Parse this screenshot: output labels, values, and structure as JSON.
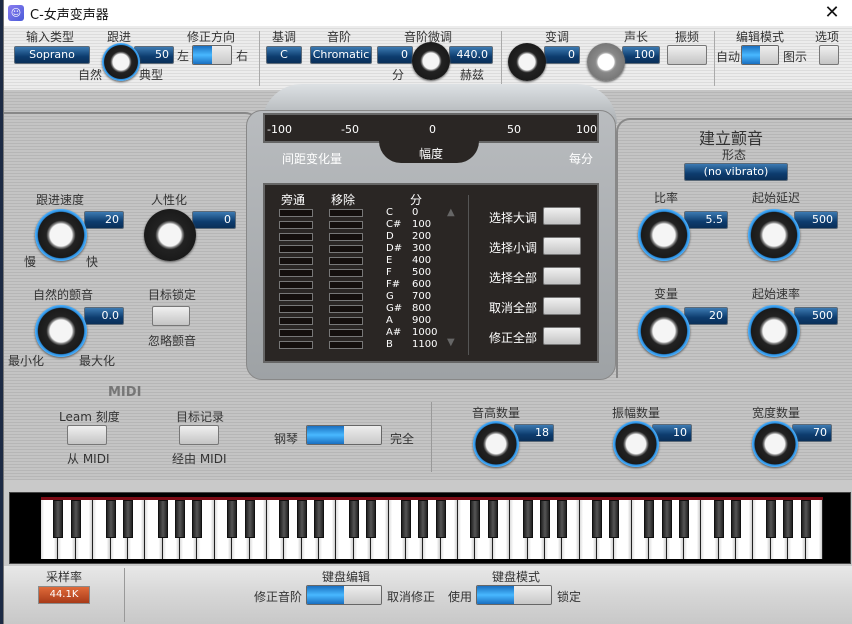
{
  "window": {
    "title": "C-女声变声器",
    "close_icon": "✕"
  },
  "top": {
    "input_type": {
      "label": "输入类型",
      "value": "Soprano"
    },
    "retune": {
      "label": "跟进",
      "value": "50",
      "left": "自然",
      "right": "典型"
    },
    "correction_dir": {
      "label": "修正方向",
      "left": "左",
      "right": "右",
      "state": "left"
    },
    "key": {
      "label": "基调",
      "value": "C"
    },
    "scale": {
      "label": "音阶",
      "value": "Chromatic"
    },
    "scale_detune": {
      "label": "音阶微调",
      "cents": "0",
      "hz": "440.0",
      "minus_label": "分",
      "plus_label": "赫兹"
    },
    "transpose": {
      "label": "变调",
      "value": "0"
    },
    "formant": {
      "label": "声长",
      "value": "100"
    },
    "vibrato_btn": {
      "label": "振频"
    },
    "edit_mode": {
      "label": "编辑模式",
      "left": "自动",
      "right": "图示",
      "state": "left"
    },
    "options": {
      "label": "选项"
    },
    "minus": "-",
    "plus": "+"
  },
  "meter": {
    "ticks": [
      "-100",
      "-50",
      "0",
      "50",
      "100"
    ],
    "left_label": "间距变化量",
    "center_label": "幅度",
    "right_label": "每分"
  },
  "left": {
    "tracking": {
      "label": "跟进速度",
      "value": "20",
      "min": "慢",
      "max": "快"
    },
    "humanize": {
      "label": "人性化",
      "value": "0"
    },
    "natural_vibrato": {
      "label": "自然的颤音",
      "value": "0.0",
      "min": "最小化",
      "max": "最大化"
    },
    "target_lock": {
      "label": "目标锁定",
      "sub": "忽略颤音"
    }
  },
  "scale_table": {
    "headers": {
      "bypass": "旁通",
      "remove": "移除",
      "cents": "分"
    },
    "rows": [
      {
        "note": "C",
        "cents": "0"
      },
      {
        "note": "C#",
        "cents": "100"
      },
      {
        "note": "D",
        "cents": "200"
      },
      {
        "note": "D#",
        "cents": "300"
      },
      {
        "note": "E",
        "cents": "400"
      },
      {
        "note": "F",
        "cents": "500"
      },
      {
        "note": "F#",
        "cents": "600"
      },
      {
        "note": "G",
        "cents": "700"
      },
      {
        "note": "G#",
        "cents": "800"
      },
      {
        "note": "A",
        "cents": "900"
      },
      {
        "note": "A#",
        "cents": "1000"
      },
      {
        "note": "B",
        "cents": "1100"
      }
    ],
    "buttons": [
      "选择大调",
      "选择小调",
      "选择全部",
      "取消全部",
      "修正全部"
    ]
  },
  "vibrato": {
    "title": "建立颤音",
    "shape_label": "形态",
    "shape": "(no vibrato)",
    "rate": {
      "label": "比率",
      "value": "5.5"
    },
    "onset_delay": {
      "label": "起始延迟",
      "value": "500"
    },
    "variation": {
      "label": "变量",
      "value": "20"
    },
    "onset_rate": {
      "label": "起始速率",
      "value": "500"
    }
  },
  "midi": {
    "title": "MIDI",
    "learn": {
      "label": "Leam 刻度",
      "sub": "从 MIDI"
    },
    "target": {
      "label": "目标记录",
      "sub": "经由 MIDI"
    },
    "piano_toggle": {
      "left": "钢琴",
      "right": "完全",
      "state": "left"
    }
  },
  "amounts": {
    "pitch": {
      "label": "音高数量",
      "value": "18"
    },
    "amplitude": {
      "label": "振幅数量",
      "value": "10"
    },
    "width": {
      "label": "宽度数量",
      "value": "70"
    }
  },
  "keyboard": {
    "first_note": "G",
    "white_keys": 45
  },
  "bottom": {
    "sample_rate": {
      "label": "采样率",
      "value": "44.1K"
    },
    "kb_edit": {
      "label": "键盘编辑",
      "left": "修正音阶",
      "right": "取消修正",
      "state": "left"
    },
    "kb_mode": {
      "label": "键盘模式",
      "left": "使用",
      "right": "锁定",
      "state": "left"
    }
  }
}
